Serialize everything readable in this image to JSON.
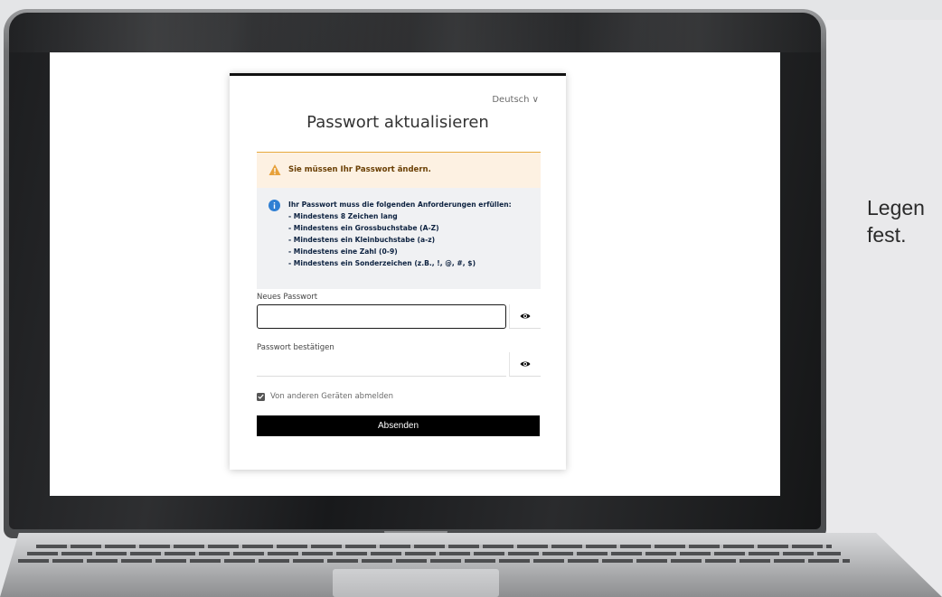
{
  "side_panel": {
    "text": "Legen\nfest."
  },
  "form": {
    "language_label": "Deutsch ∨",
    "title": "Passwort aktualisieren",
    "warning": {
      "text": "Sie müssen Ihr Passwort ändern.",
      "icon": "warning-triangle-icon",
      "color": "#e7a93d"
    },
    "info": {
      "icon": "info-circle-icon",
      "lines": [
        "Ihr Passwort muss die folgenden Anforderungen erfüllen:",
        "- Mindestens 8 Zeichen lang",
        "- Mindestens ein Grossbuchstabe (A-Z)",
        "- Mindestens ein Kleinbuchstabe (a-z)",
        "- Mindestens eine Zahl (0-9)",
        "- Mindestens ein Sonderzeichen (z.B., !, @, #, $)"
      ]
    },
    "new_password": {
      "label": "Neues Passwort",
      "value": "",
      "toggle_icon": "eye-icon"
    },
    "confirm_password": {
      "label": "Passwort bestätigen",
      "value": "",
      "toggle_icon": "eye-icon"
    },
    "logout_other_devices": {
      "label": "Von anderen Geräten abmelden",
      "checked": true
    },
    "submit_label": "Absenden"
  }
}
